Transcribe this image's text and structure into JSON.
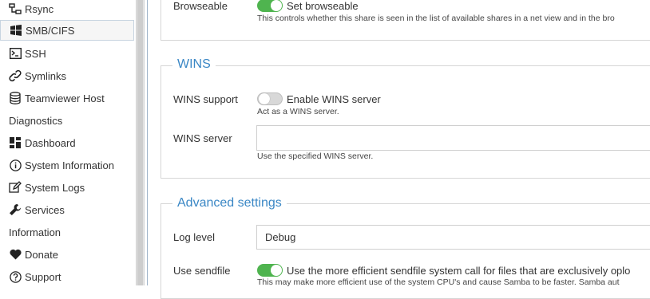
{
  "sidebar": {
    "items": [
      {
        "label": "Rsync",
        "icon": "rsync-icon"
      },
      {
        "label": "SMB/CIFS",
        "icon": "windows-icon"
      },
      {
        "label": "SSH",
        "icon": "terminal-icon"
      },
      {
        "label": "Symlinks",
        "icon": "link-icon"
      },
      {
        "label": "Teamviewer Host",
        "icon": "database-icon"
      }
    ],
    "diagnostics_heading": "Diagnostics",
    "diagnostics": [
      {
        "label": "Dashboard",
        "icon": "dashboard-icon"
      },
      {
        "label": "System Information",
        "icon": "info-icon"
      },
      {
        "label": "System Logs",
        "icon": "edit-icon"
      },
      {
        "label": "Services",
        "icon": "wrench-icon"
      }
    ],
    "information_heading": "Information",
    "information": [
      {
        "label": "Donate",
        "icon": "heart-icon"
      },
      {
        "label": "Support",
        "icon": "question-icon"
      }
    ]
  },
  "browseable": {
    "label": "Browseable",
    "toggle_text": "Set browseable",
    "enabled": true,
    "help": "This controls whether this share is seen in the list of available shares in a net view and in the bro"
  },
  "wins": {
    "legend": "WINS",
    "support_label": "WINS support",
    "support_toggle_text": "Enable WINS server",
    "support_enabled": false,
    "support_help": "Act as a WINS server.",
    "server_label": "WINS server",
    "server_value": "",
    "server_help": "Use the specified WINS server."
  },
  "advanced": {
    "legend": "Advanced settings",
    "log_level_label": "Log level",
    "log_level_value": "Debug",
    "sendfile_label": "Use sendfile",
    "sendfile_text": "Use the more efficient sendfile system call for files that are exclusively oplo",
    "sendfile_enabled": true,
    "sendfile_help": "This may make more efficient use of the system CPU's and cause Samba to be faster. Samba aut"
  },
  "colors": {
    "accent": "#3a87c5",
    "toggle_on": "#4fb44f"
  }
}
